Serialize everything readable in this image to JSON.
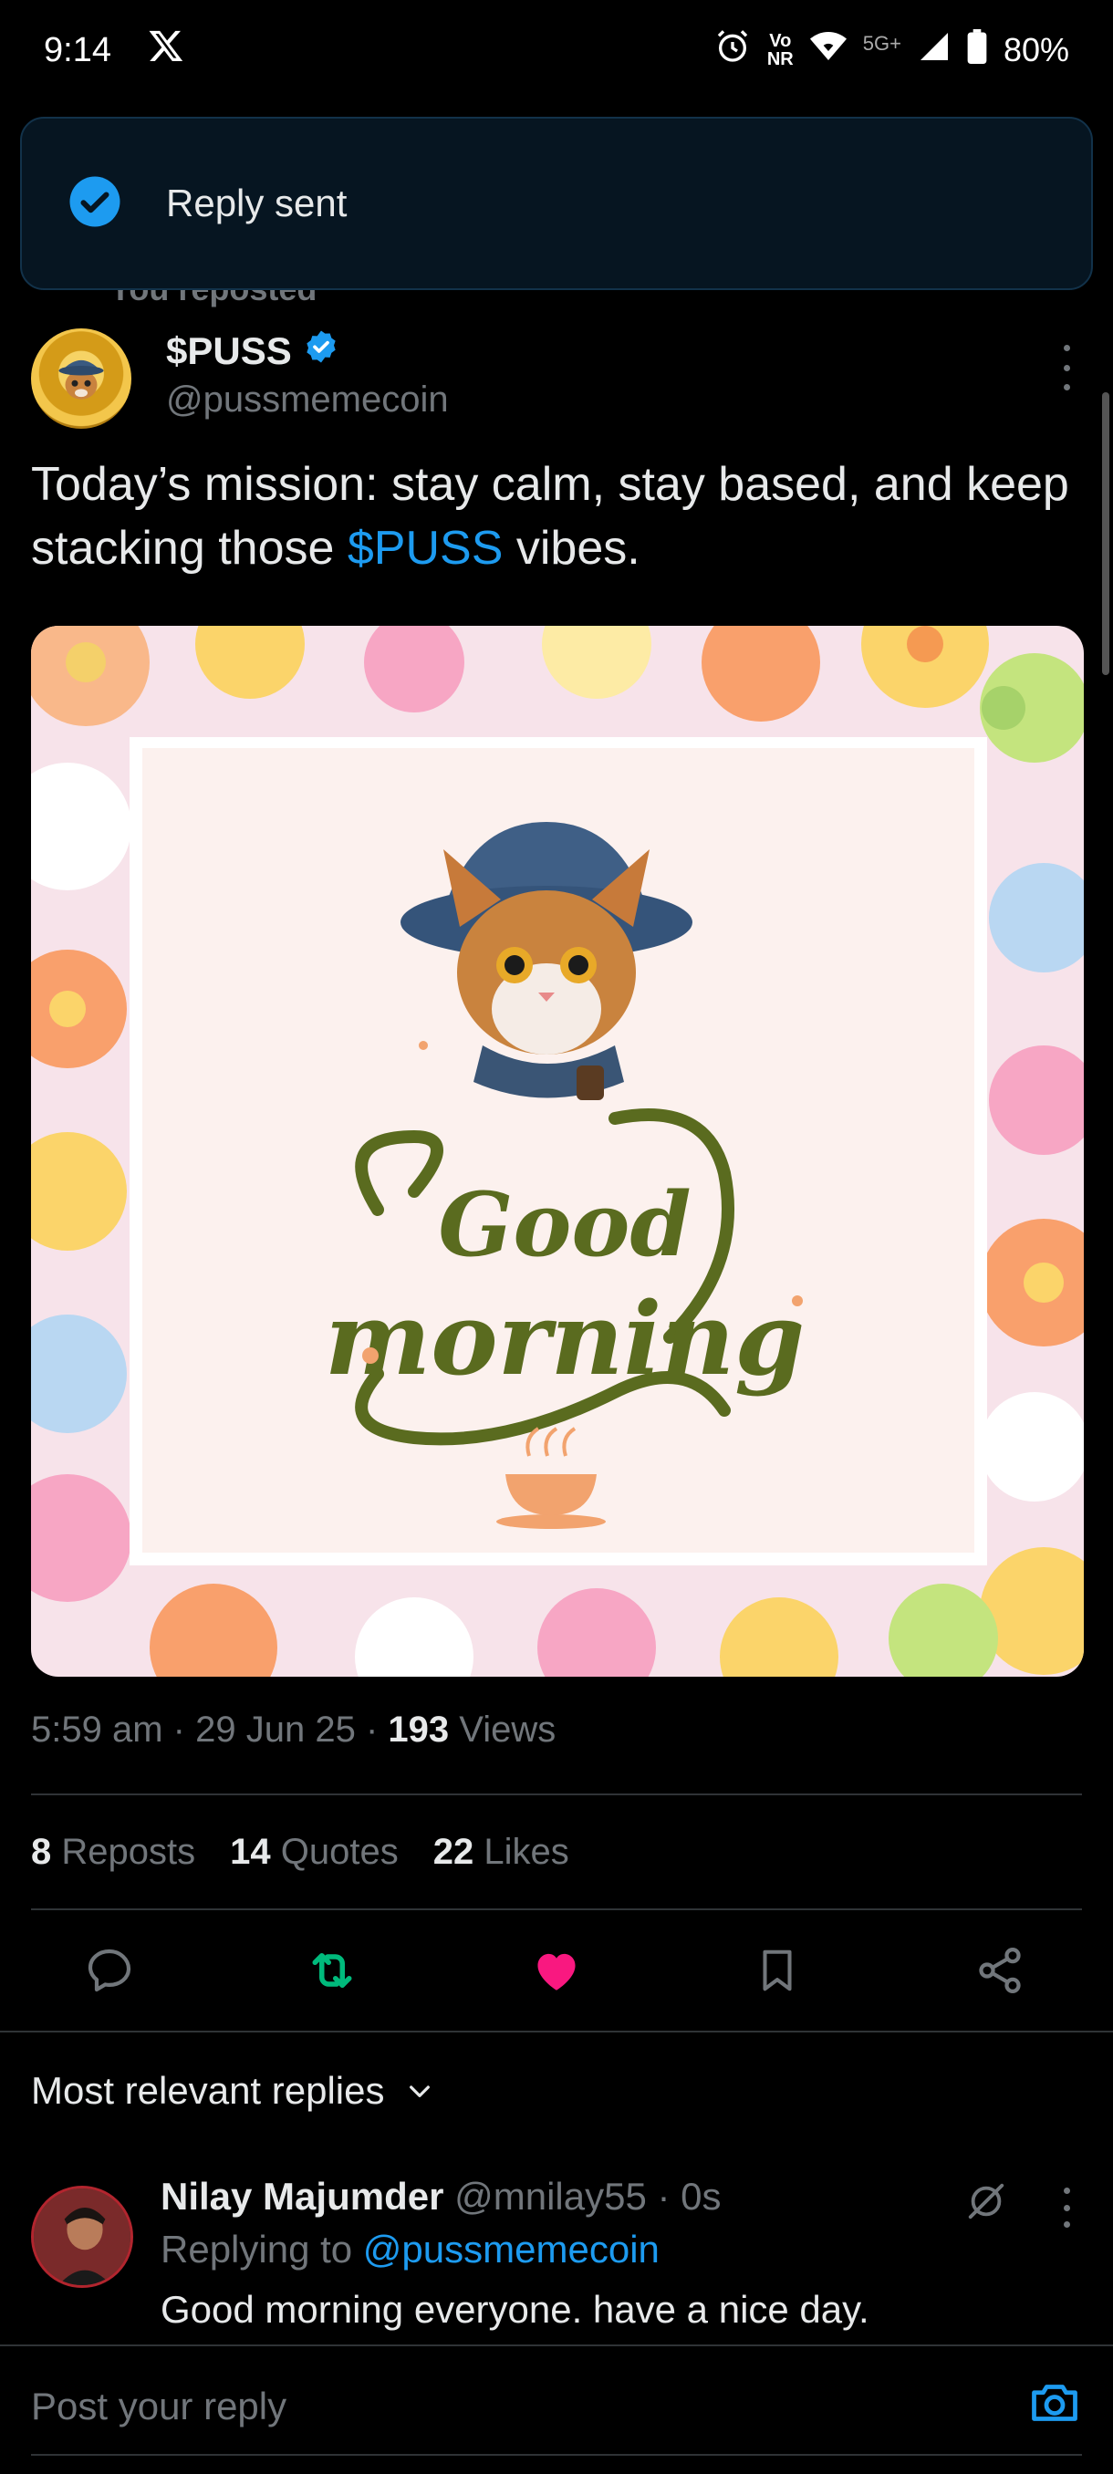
{
  "status_bar": {
    "time": "9:14",
    "network_top": "Vo",
    "network_bottom": "NR",
    "generation": "5G+",
    "battery": "80%"
  },
  "toast": {
    "text": "Reply sent"
  },
  "repost_context": "You reposted",
  "tweet": {
    "author_name": "$PUSS",
    "author_handle": "@pussmemecoin",
    "text_before": "Today’s mission: stay calm, stay based, and keep stacking those ",
    "cashtag": "$PUSS",
    "text_after": " vibes.",
    "media_text_line1": "Good",
    "media_text_line2": "morning",
    "time": "5:59 am",
    "date": "29 Jun 25",
    "views_count": "193",
    "views_label": "Views",
    "separator": "·"
  },
  "stats": {
    "reposts_count": "8",
    "reposts_label": "Reposts",
    "quotes_count": "14",
    "quotes_label": "Quotes",
    "likes_count": "22",
    "likes_label": "Likes"
  },
  "colors": {
    "accent": "#1d9bf0",
    "repost_active": "#00ba7c",
    "like_active": "#f91880"
  },
  "sort": {
    "label": "Most relevant replies"
  },
  "reply": {
    "name": "Nilay Majumder",
    "handle_time": "@mnilay55 · 0s",
    "replying_prefix": "Replying to ",
    "replying_to": "@pussmemecoin",
    "text": "Good morning everyone. have a nice day."
  },
  "composer": {
    "placeholder": "Post your reply"
  }
}
